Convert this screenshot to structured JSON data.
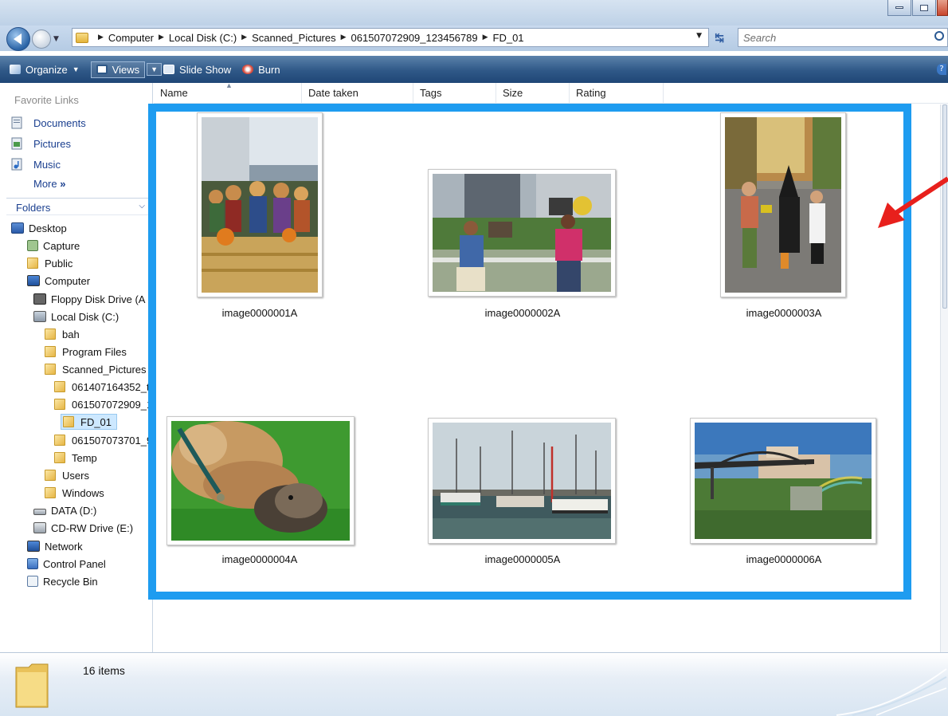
{
  "address": {
    "crumbs": [
      "Computer",
      "Local Disk (C:)",
      "Scanned_Pictures",
      "061507072909_123456789",
      "FD_01"
    ],
    "search_placeholder": "Search"
  },
  "commandbar": {
    "organize": "Organize",
    "views": "Views",
    "slideshow": "Slide Show",
    "burn": "Burn"
  },
  "navpane": {
    "favorites_heading": "Favorite Links",
    "favorites": [
      "Documents",
      "Pictures",
      "Music"
    ],
    "more": "More",
    "more_chevron": "»",
    "folders_heading": "Folders",
    "tree": [
      {
        "label": "Desktop",
        "icon": "desktop-icon"
      },
      {
        "label": "Capture",
        "icon": "capture-icon"
      },
      {
        "label": "Public",
        "icon": "folder-icon"
      },
      {
        "label": "Computer",
        "icon": "computer-icon"
      },
      {
        "label": "Floppy Disk Drive (A",
        "icon": "floppy-icon"
      },
      {
        "label": "Local Disk (C:)",
        "icon": "hard-disk-icon"
      },
      {
        "label": "bah",
        "icon": "folder-icon"
      },
      {
        "label": "Program Files",
        "icon": "folder-icon"
      },
      {
        "label": "Scanned_Pictures",
        "icon": "folder-icon"
      },
      {
        "label": "061407164352_t",
        "icon": "folder-icon"
      },
      {
        "label": "061507072909_1",
        "icon": "folder-icon"
      },
      {
        "label": "FD_01",
        "icon": "folder-icon",
        "selected": true
      },
      {
        "label": "061507073701_9",
        "icon": "folder-icon"
      },
      {
        "label": "Temp",
        "icon": "folder-icon"
      },
      {
        "label": "Users",
        "icon": "folder-icon"
      },
      {
        "label": "Windows",
        "icon": "folder-icon"
      },
      {
        "label": "DATA (D:)",
        "icon": "drive-icon"
      },
      {
        "label": "CD-RW Drive (E:)",
        "icon": "cd-drive-icon"
      },
      {
        "label": "Network",
        "icon": "network-icon"
      },
      {
        "label": "Control Panel",
        "icon": "control-panel-icon"
      },
      {
        "label": "Recycle Bin",
        "icon": "recycle-bin-icon"
      }
    ]
  },
  "columns": [
    "Name",
    "Date taken",
    "Tags",
    "Size",
    "Rating"
  ],
  "files": [
    {
      "name": "image0000001A",
      "subject": "scarecrows-photo"
    },
    {
      "name": "image0000002A",
      "subject": "two-women-photo"
    },
    {
      "name": "image0000003A",
      "subject": "costumed-children-photo"
    },
    {
      "name": "image0000004A",
      "subject": "dog-and-puppy-photo"
    },
    {
      "name": "image0000005A",
      "subject": "fishing-boats-photo"
    },
    {
      "name": "image0000006A",
      "subject": "bridge-rainbow-photo"
    }
  ],
  "status": {
    "item_count": "16 items"
  },
  "colors": {
    "highlight": "#1e9cf0",
    "arrow": "#e8201c"
  }
}
